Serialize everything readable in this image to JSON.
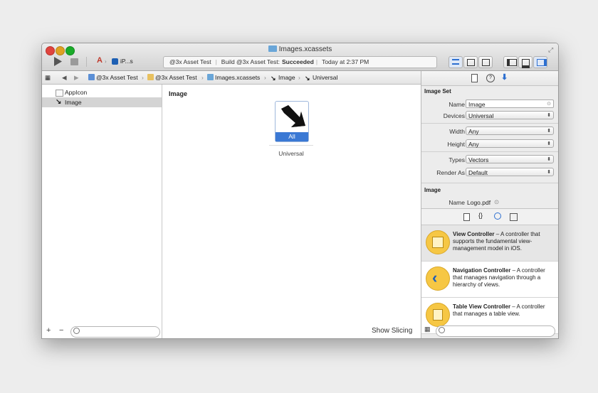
{
  "window": {
    "title": "Images.xcassets"
  },
  "toolbar": {
    "scheme_label": "iP...s",
    "status": {
      "project": "@3x Asset Test",
      "build_prefix": "Build @3x Asset Test:",
      "build_result": "Succeeded",
      "time": "Today at 2:37 PM"
    }
  },
  "jumpbar": {
    "crumbs": [
      "@3x Asset Test",
      "@3x Asset Test",
      "Images.xcassets",
      "Image",
      "Universal"
    ]
  },
  "navigator": {
    "items": [
      {
        "label": "AppIcon"
      },
      {
        "label": "Image"
      }
    ]
  },
  "editor": {
    "heading": "Image",
    "slot_badge": "All",
    "slot_caption": "Universal",
    "show_slicing": "Show Slicing"
  },
  "inspector": {
    "image_set_title": "Image Set",
    "name_label": "Name",
    "name_value": "Image",
    "devices_label": "Devices",
    "devices_value": "Universal",
    "width_label": "Width",
    "width_value": "Any",
    "height_label": "Height",
    "height_value": "Any",
    "types_label": "Types",
    "types_value": "Vectors",
    "render_label": "Render As",
    "render_value": "Default",
    "image_title": "Image",
    "image_name_label": "Name",
    "image_name_value": "Logo.pdf"
  },
  "library": {
    "items": [
      {
        "title": "View Controller",
        "desc": " – A controller that supports the fundamental view-management model in iOS."
      },
      {
        "title": "Navigation Controller",
        "desc": " – A controller that manages navigation through a hierarchy of views."
      },
      {
        "title": "Table View Controller",
        "desc": " – A controller that manages a table view."
      }
    ]
  },
  "colors": {
    "accent": "#3a78d4",
    "traffic_close": "#e0443e",
    "traffic_min": "#dea123",
    "traffic_max": "#1aab29"
  }
}
